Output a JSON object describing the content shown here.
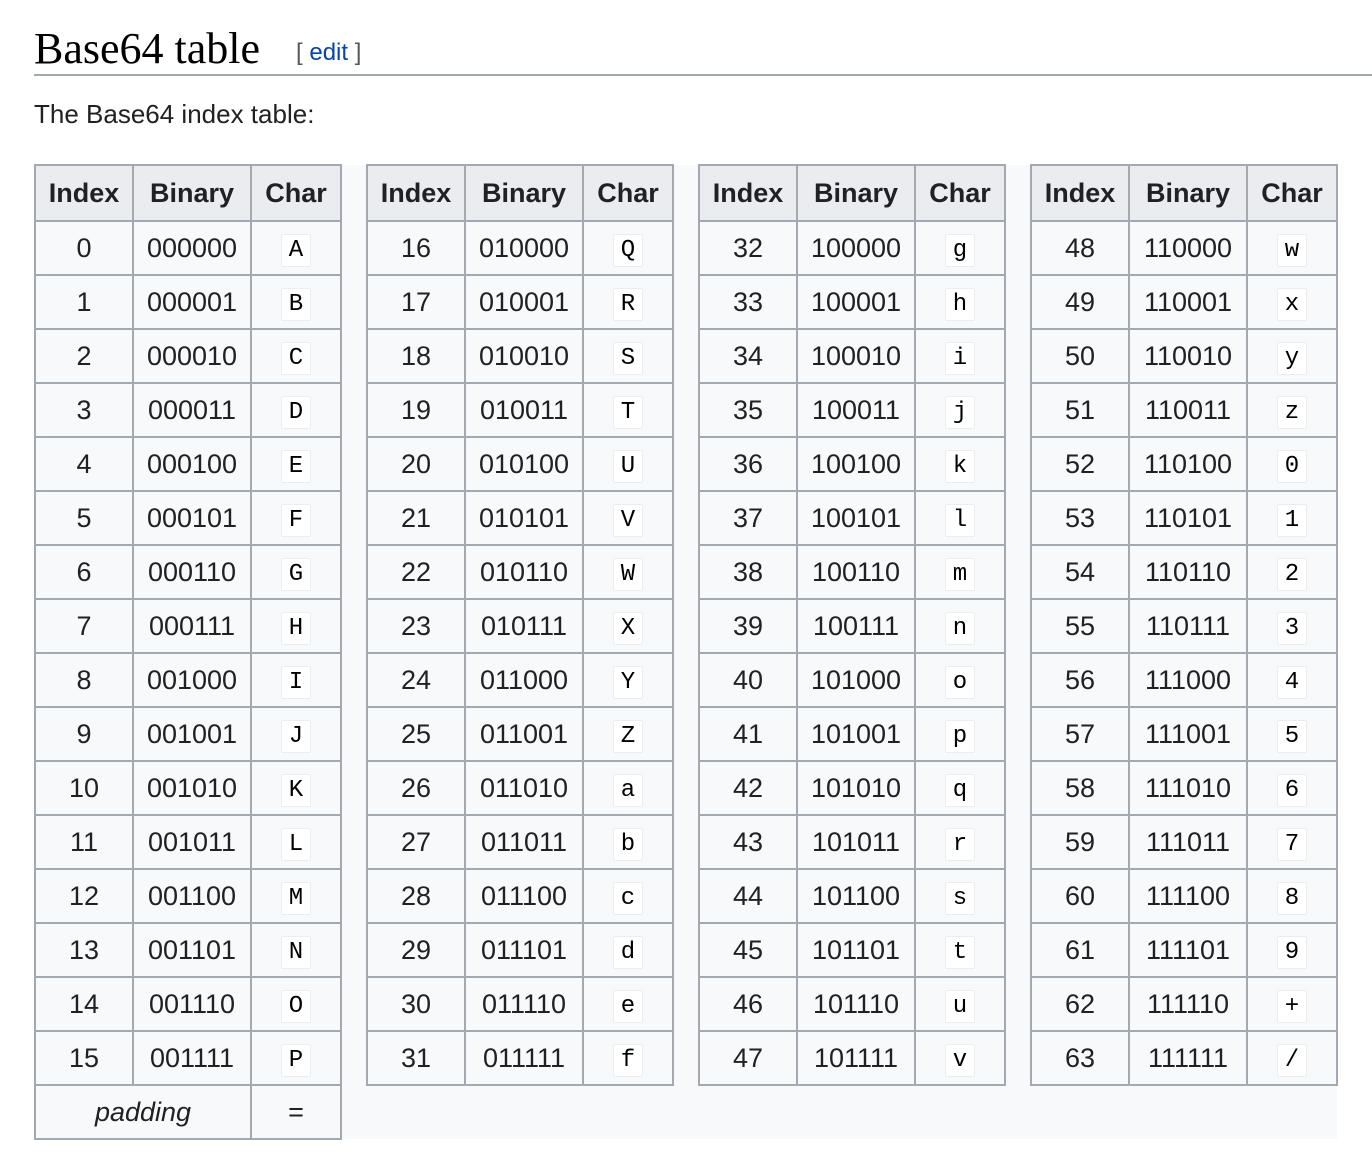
{
  "heading": {
    "title": "Base64 table",
    "edit_open": "[ ",
    "edit_label": "edit",
    "edit_close": " ]"
  },
  "intro": "The Base64 index table:",
  "table": {
    "headers": [
      "Index",
      "Binary",
      "Char"
    ],
    "rows": [
      [
        "0",
        "000000",
        "A"
      ],
      [
        "1",
        "000001",
        "B"
      ],
      [
        "2",
        "000010",
        "C"
      ],
      [
        "3",
        "000011",
        "D"
      ],
      [
        "4",
        "000100",
        "E"
      ],
      [
        "5",
        "000101",
        "F"
      ],
      [
        "6",
        "000110",
        "G"
      ],
      [
        "7",
        "000111",
        "H"
      ],
      [
        "8",
        "001000",
        "I"
      ],
      [
        "9",
        "001001",
        "J"
      ],
      [
        "10",
        "001010",
        "K"
      ],
      [
        "11",
        "001011",
        "L"
      ],
      [
        "12",
        "001100",
        "M"
      ],
      [
        "13",
        "001101",
        "N"
      ],
      [
        "14",
        "001110",
        "O"
      ],
      [
        "15",
        "001111",
        "P"
      ],
      [
        "16",
        "010000",
        "Q"
      ],
      [
        "17",
        "010001",
        "R"
      ],
      [
        "18",
        "010010",
        "S"
      ],
      [
        "19",
        "010011",
        "T"
      ],
      [
        "20",
        "010100",
        "U"
      ],
      [
        "21",
        "010101",
        "V"
      ],
      [
        "22",
        "010110",
        "W"
      ],
      [
        "23",
        "010111",
        "X"
      ],
      [
        "24",
        "011000",
        "Y"
      ],
      [
        "25",
        "011001",
        "Z"
      ],
      [
        "26",
        "011010",
        "a"
      ],
      [
        "27",
        "011011",
        "b"
      ],
      [
        "28",
        "011100",
        "c"
      ],
      [
        "29",
        "011101",
        "d"
      ],
      [
        "30",
        "011110",
        "e"
      ],
      [
        "31",
        "011111",
        "f"
      ],
      [
        "32",
        "100000",
        "g"
      ],
      [
        "33",
        "100001",
        "h"
      ],
      [
        "34",
        "100010",
        "i"
      ],
      [
        "35",
        "100011",
        "j"
      ],
      [
        "36",
        "100100",
        "k"
      ],
      [
        "37",
        "100101",
        "l"
      ],
      [
        "38",
        "100110",
        "m"
      ],
      [
        "39",
        "100111",
        "n"
      ],
      [
        "40",
        "101000",
        "o"
      ],
      [
        "41",
        "101001",
        "p"
      ],
      [
        "42",
        "101010",
        "q"
      ],
      [
        "43",
        "101011",
        "r"
      ],
      [
        "44",
        "101100",
        "s"
      ],
      [
        "45",
        "101101",
        "t"
      ],
      [
        "46",
        "101110",
        "u"
      ],
      [
        "47",
        "101111",
        "v"
      ],
      [
        "48",
        "110000",
        "w"
      ],
      [
        "49",
        "110001",
        "x"
      ],
      [
        "50",
        "110010",
        "y"
      ],
      [
        "51",
        "110011",
        "z"
      ],
      [
        "52",
        "110100",
        "0"
      ],
      [
        "53",
        "110101",
        "1"
      ],
      [
        "54",
        "110110",
        "2"
      ],
      [
        "55",
        "110111",
        "3"
      ],
      [
        "56",
        "111000",
        "4"
      ],
      [
        "57",
        "111001",
        "5"
      ],
      [
        "58",
        "111010",
        "6"
      ],
      [
        "59",
        "111011",
        "7"
      ],
      [
        "60",
        "111100",
        "8"
      ],
      [
        "61",
        "111101",
        "9"
      ],
      [
        "62",
        "111110",
        "+"
      ],
      [
        "63",
        "111111",
        "/"
      ]
    ],
    "padding_label": "padding",
    "padding_char": "="
  },
  "colors": {
    "border": "#a2a9b1",
    "header_bg": "#eaecf0",
    "cell_bg": "#f8f9fa",
    "link": "#0645ad"
  }
}
